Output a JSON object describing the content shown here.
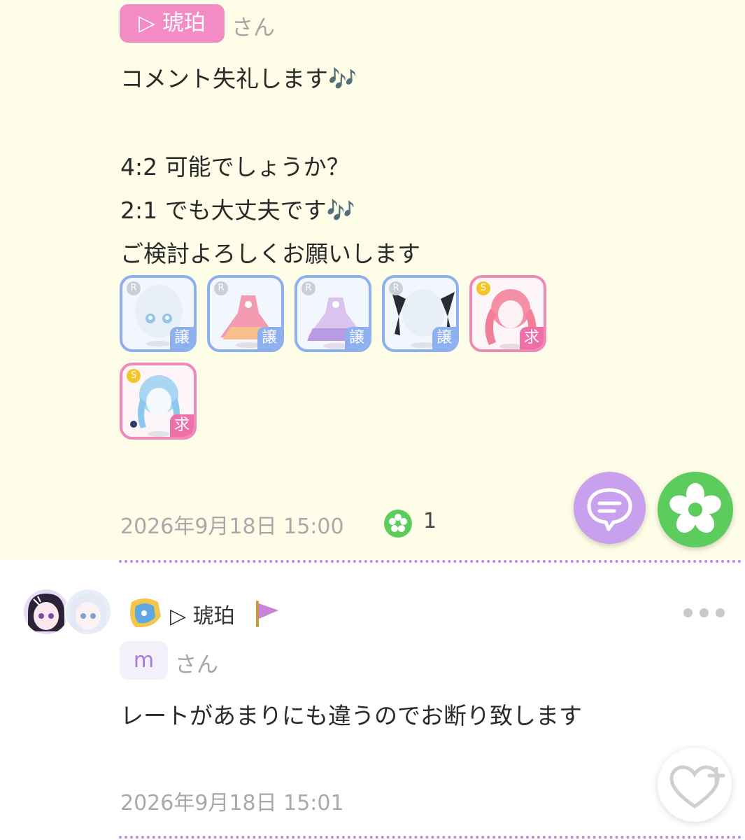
{
  "post": {
    "reply_to_name": "▷ 琥珀",
    "honorific": "さん",
    "lines": [
      "コメント失礼します🎶",
      "",
      "4:2 可能でしょうか？",
      "2:1 でも大丈夫です🎶",
      "ご検討よろしくお願いします"
    ],
    "items": [
      {
        "rarity": "R",
        "tag": "譲",
        "icon": "eyes-icon"
      },
      {
        "rarity": "R",
        "tag": "譲",
        "icon": "pink-dress-icon"
      },
      {
        "rarity": "R",
        "tag": "譲",
        "icon": "lavender-dress-icon"
      },
      {
        "rarity": "R",
        "tag": "譲",
        "icon": "black-ribbon-icon"
      },
      {
        "rarity": "S",
        "tag": "求",
        "icon": "pink-twintail-hair-icon"
      },
      {
        "rarity": "S",
        "tag": "求",
        "icon": "blue-braid-hair-icon"
      }
    ],
    "timestamp": "2026年9月18日 15:00",
    "like_count": "1",
    "colors": {
      "bg": "#fefde7",
      "tag": "#f38cc4",
      "comment_fab": "#c8a0ee",
      "flower_fab": "#5ccc5c"
    }
  },
  "reply": {
    "author": "▷ 琥珀",
    "reply_to_name": "m",
    "honorific": "さん",
    "text": "レートがあまりにも違うのでお断り致します",
    "timestamp": "2026年9月18日 15:01"
  }
}
